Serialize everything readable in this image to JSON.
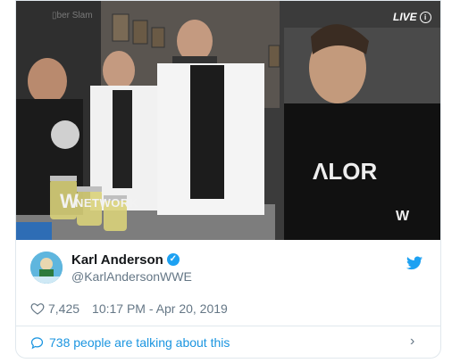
{
  "media": {
    "live_badge": "LIVE",
    "network_label": "NETWORK",
    "network_logo_letter": "W",
    "corner_logo": "W"
  },
  "author": {
    "display_name": "Karl Anderson",
    "handle": "@KarlAndersonWWE",
    "verified": true
  },
  "meta": {
    "likes": "7,425",
    "timestamp": "10:17 PM - Apr 20, 2019"
  },
  "footer": {
    "talking": "738 people are talking about this"
  },
  "colors": {
    "twitter_blue": "#1da1f2",
    "link_blue": "#1b95e0",
    "muted": "#657786"
  }
}
